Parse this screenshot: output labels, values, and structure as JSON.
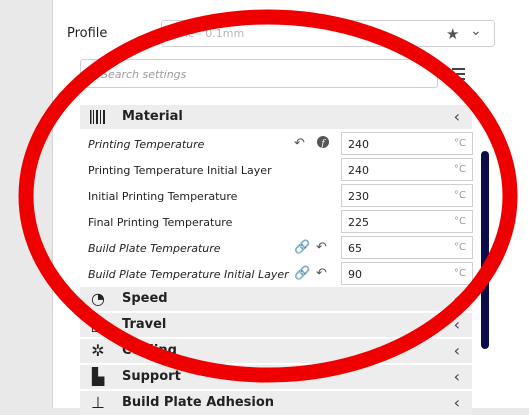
{
  "profile": {
    "label": "Profile",
    "value": "Fine - 0.1mm"
  },
  "search": {
    "placeholder": "Search settings"
  },
  "material": {
    "label": "Material",
    "rows": [
      {
        "label": "Printing Temperature",
        "value": "240",
        "unit": "°C"
      },
      {
        "label": "Printing Temperature Initial Layer",
        "value": "240",
        "unit": "°C"
      },
      {
        "label": "Initial Printing Temperature",
        "value": "230",
        "unit": "°C"
      },
      {
        "label": "Final Printing Temperature",
        "value": "225",
        "unit": "°C"
      },
      {
        "label": "Build Plate Temperature",
        "value": "65",
        "unit": "°C"
      },
      {
        "label": "Build Plate Temperature Initial Layer",
        "value": "90",
        "unit": "°C"
      }
    ]
  },
  "categories": {
    "speed": "Speed",
    "travel": "Travel",
    "cooling": "Cooling",
    "support": "Support",
    "adhesion": "Build Plate Adhesion"
  },
  "colors": {
    "annotation": "#ee0000",
    "scrollbar": "#0c0c4a"
  }
}
